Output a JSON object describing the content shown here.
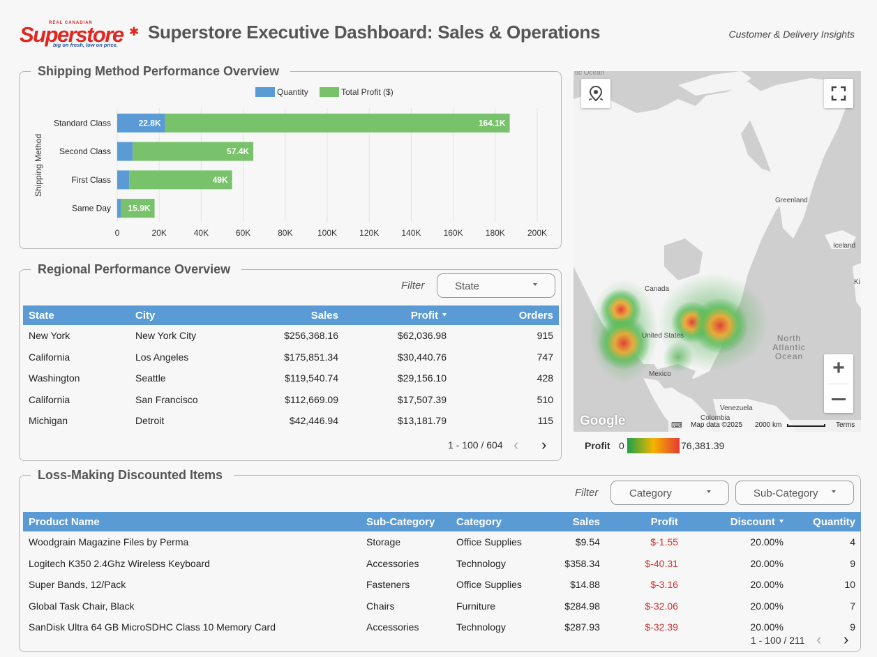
{
  "header": {
    "logo_top": "REAL CANADIAN",
    "logo_main": "Superstore",
    "logo_tag": "big on fresh, low on price.",
    "title": "Superstore Executive Dashboard: Sales & Operations",
    "subtitle": "Customer & Delivery Insights"
  },
  "shipping": {
    "title": "Shipping Method Performance Overview",
    "legend": [
      "Quantity",
      "Total Profit ($)"
    ],
    "ylabel": "Shipping Method"
  },
  "chart_data": {
    "type": "bar",
    "orientation": "horizontal",
    "stacked": true,
    "categories": [
      "Standard Class",
      "Second Class",
      "First Class",
      "Same Day"
    ],
    "series": [
      {
        "name": "Quantity",
        "color": "#5b9bd5",
        "values": [
          22800,
          7400,
          5700,
          1900
        ],
        "labels": [
          "22.8K",
          "7.4K",
          "5.7K",
          ""
        ]
      },
      {
        "name": "Total Profit ($)",
        "color": "#77c26a",
        "values": [
          164100,
          57400,
          49000,
          15900
        ],
        "labels": [
          "164.1K",
          "57.4K",
          "49K",
          "15.9K"
        ]
      }
    ],
    "xlabel": "",
    "ylabel": "Shipping Method",
    "xlim": [
      0,
      200000
    ],
    "xticks": [
      "0",
      "20K",
      "40K",
      "60K",
      "80K",
      "100K",
      "120K",
      "140K",
      "160K",
      "180K",
      "200K"
    ],
    "grid": true,
    "legend_position": "top"
  },
  "regional": {
    "title": "Regional Performance Overview",
    "filter_label": "Filter",
    "filter_state": "State",
    "columns": [
      "State",
      "City",
      "Sales",
      "Profit",
      "Orders"
    ],
    "rows": [
      [
        "New York",
        "New York City",
        "$256,368.16",
        "$62,036.98",
        "915"
      ],
      [
        "California",
        "Los Angeles",
        "$175,851.34",
        "$30,440.76",
        "747"
      ],
      [
        "Washington",
        "Seattle",
        "$119,540.74",
        "$29,156.10",
        "428"
      ],
      [
        "California",
        "San Francisco",
        "$112,669.09",
        "$17,507.39",
        "510"
      ],
      [
        "Michigan",
        "Detroit",
        "$42,446.94",
        "$13,181.79",
        "115"
      ]
    ],
    "pager": "1 - 100 / 604"
  },
  "map": {
    "labels": {
      "canada": "Canada",
      "us": "United States",
      "mexico": "Mexico",
      "greenland": "Greenland",
      "iceland": "Iceland",
      "venezuela": "Venezuela",
      "colombia": "Colombia",
      "atlantic": "North Atlantic Ocean",
      "top_ocean": "tic Ocean",
      "edge": "Ki"
    },
    "google": "Google",
    "map_data": "Map data ©2025",
    "scale": "2000 km",
    "terms": "Terms",
    "legend_label": "Profit",
    "legend_min": "0",
    "legend_max": "76,381.39"
  },
  "loss": {
    "title": "Loss-Making Discounted Items",
    "filter_label": "Filter",
    "filter_category": "Category",
    "filter_subcategory": "Sub-Category",
    "columns": [
      "Product Name",
      "Sub-Category",
      "Category",
      "Sales",
      "Profit",
      "Discount",
      "Quantity"
    ],
    "rows": [
      [
        "Woodgrain Magazine Files by Perma",
        "Storage",
        "Office Supplies",
        "$9.54",
        "$-1.55",
        "20.00%",
        "4"
      ],
      [
        "Logitech K350 2.4Ghz Wireless Keyboard",
        "Accessories",
        "Technology",
        "$358.34",
        "$-40.31",
        "20.00%",
        "9"
      ],
      [
        "Super Bands, 12/Pack",
        "Fasteners",
        "Office Supplies",
        "$14.88",
        "$-3.16",
        "20.00%",
        "10"
      ],
      [
        "Global Task Chair, Black",
        "Chairs",
        "Furniture",
        "$284.98",
        "$-32.06",
        "20.00%",
        "7"
      ],
      [
        "SanDisk Ultra 64 GB MicroSDHC Class 10 Memory Card",
        "Accessories",
        "Technology",
        "$287.93",
        "$-32.39",
        "20.00%",
        "9"
      ]
    ],
    "pager": "1 - 100 / 211"
  }
}
